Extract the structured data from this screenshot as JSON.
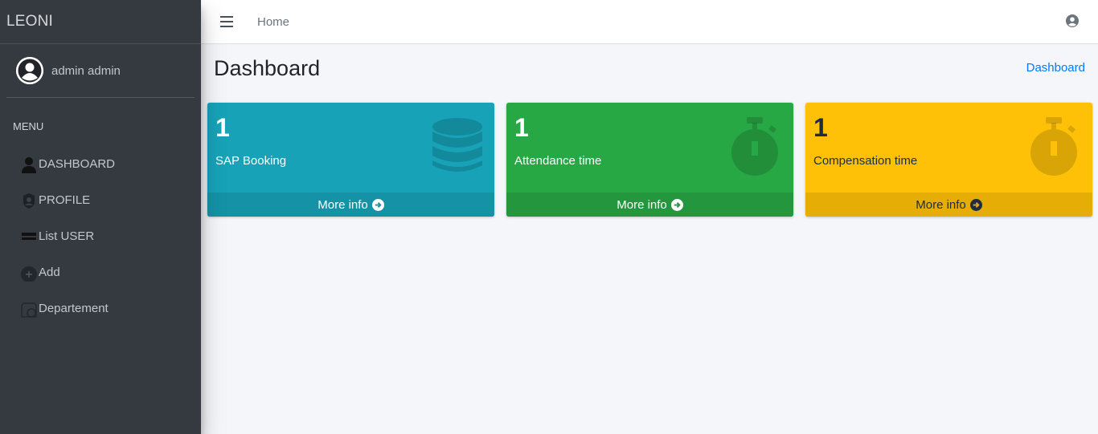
{
  "brand": {
    "name": "LEONI"
  },
  "user": {
    "name": "admin admin"
  },
  "sidebar": {
    "header": "MENU",
    "items": [
      {
        "label": "DASHBOARD",
        "icon": "user-icon"
      },
      {
        "label": "PROFILE",
        "icon": "id-badge-icon"
      },
      {
        "label": "List USER",
        "icon": "list-icon"
      },
      {
        "label": "Add",
        "icon": "plus-circle-icon"
      },
      {
        "label": "Departement",
        "icon": "building-icon"
      }
    ]
  },
  "topbar": {
    "home": "Home",
    "menu_icon": "bars-icon",
    "user_icon": "user-circle-icon"
  },
  "page": {
    "title": "Dashboard",
    "breadcrumb": "Dashboard"
  },
  "boxes": [
    {
      "count": "1",
      "label": "SAP Booking",
      "footer": "More info",
      "icon": "database-icon",
      "color": "#17a2b8"
    },
    {
      "count": "1",
      "label": "Attendance time",
      "footer": "More info",
      "icon": "stopwatch-icon",
      "color": "#28a745"
    },
    {
      "count": "1",
      "label": "Compensation time",
      "footer": "More info",
      "icon": "stopwatch-icon",
      "color": "#ffc107"
    }
  ]
}
